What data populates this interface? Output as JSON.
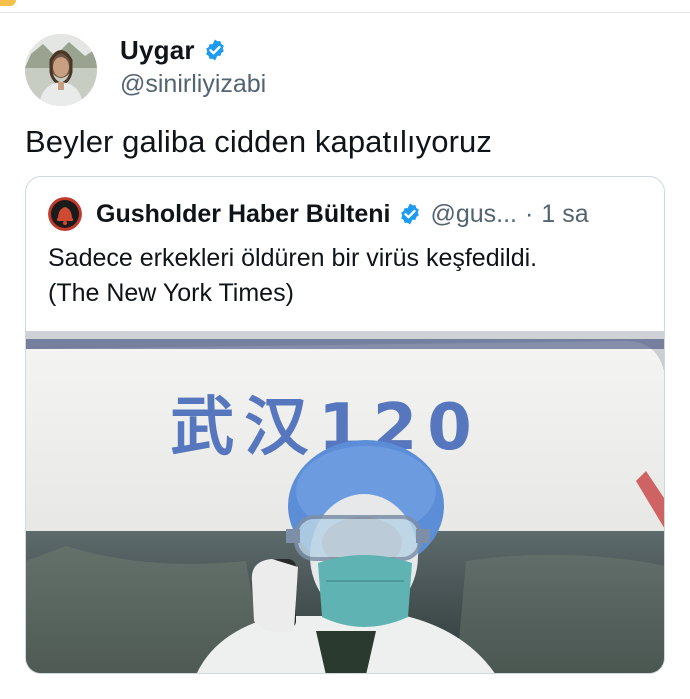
{
  "tweet": {
    "display_name": "Uygar",
    "handle": "@sinirliyizabi",
    "text": "Beyler galiba cidden kapatılıyoruz"
  },
  "quoted_tweet": {
    "display_name": "Gusholder Haber Bülteni",
    "handle": "@gus...",
    "separator": "·",
    "time": "1 sa",
    "text_lines": [
      "Sadece erkekleri öldüren bir virüs keşfedildi.",
      "(The New York Times)"
    ],
    "media": {
      "vehicle_text": "武汉120"
    }
  },
  "colors": {
    "verified": "#1d9bf0",
    "secondary_text": "#536471",
    "quote_avatar_bg": "#c0392b",
    "border": "#cfd9de"
  },
  "icons": {
    "verified": "verified-badge-icon",
    "quote_avatar": "bell-logo-icon"
  }
}
